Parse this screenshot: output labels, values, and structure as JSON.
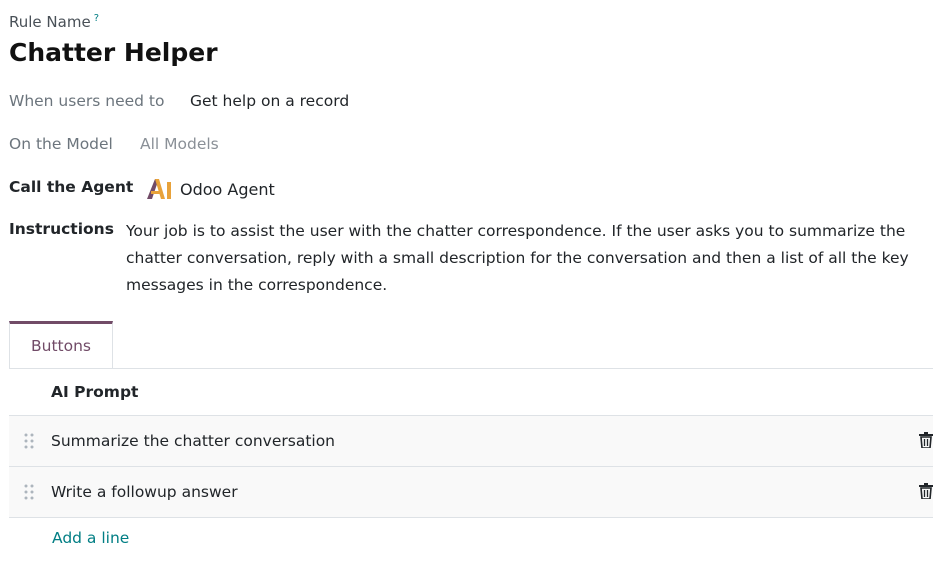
{
  "header": {
    "rule_name_label": "Rule Name",
    "help_mark": "?",
    "title": "Chatter Helper"
  },
  "fields": {
    "when_label": "When users need to",
    "when_value": "Get help on a record",
    "model_label": "On the Model",
    "model_value": "All Models",
    "agent_label": "Call the Agent",
    "agent_value": "Odoo Agent",
    "agent_icon": "ai-icon",
    "instructions_label": "Instructions",
    "instructions_value": "Your job is to assist the user with the chatter correspondence. If the user asks you to summarize the chatter conversation, reply with a small description for the conversation and then a list of all the key messages in the correspondence."
  },
  "tabs": [
    {
      "label": "Buttons",
      "active": true
    }
  ],
  "table": {
    "column_header": "AI Prompt",
    "rows": [
      {
        "prompt": "Summarize the chatter conversation"
      },
      {
        "prompt": "Write a followup answer"
      }
    ],
    "add_line_label": "Add a line"
  },
  "colors": {
    "accent": "#714b67",
    "link": "#017e84"
  }
}
